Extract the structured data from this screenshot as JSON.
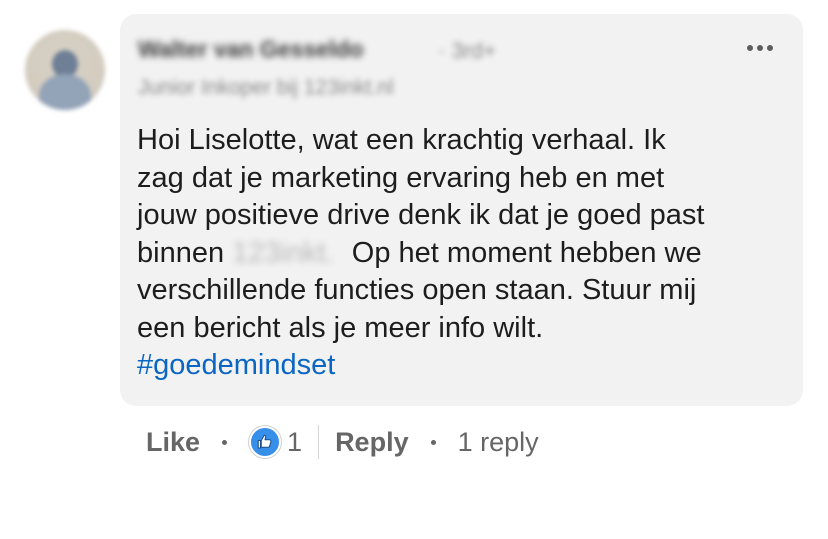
{
  "comment": {
    "author_name": "Walter van Gesseldo",
    "connection_degree": "· 3rd+",
    "author_headline": "Junior Inkoper bij 123inkt.nl",
    "text_line_1": "Hoi Liselotte, wat een krachtig verhaal. Ik",
    "text_line_2": "zag dat je marketing ervaring heb en met",
    "text_line_3": "jouw positieve drive denk ik dat je goed past",
    "text_line_4_start": "binnen",
    "text_line_4_redacted": "123inkt.",
    "text_line_4_end": "Op het moment hebben we",
    "text_line_5": "verschillende functies open staan. Stuur mij",
    "text_line_6": "een bericht als je meer info wilt.",
    "hashtag": "#goedemindset"
  },
  "actions": {
    "like_label": "Like",
    "reaction_count": "1",
    "reply_label": "Reply",
    "replies_label": "1 reply"
  },
  "icons": {
    "more": "more-options-icon",
    "reaction": "thumbs-up-icon"
  },
  "colors": {
    "bubble_bg": "#f2f2f2",
    "hashtag": "#0a66c2",
    "like_reaction": "#378fe9",
    "secondary_text": "#666666"
  }
}
